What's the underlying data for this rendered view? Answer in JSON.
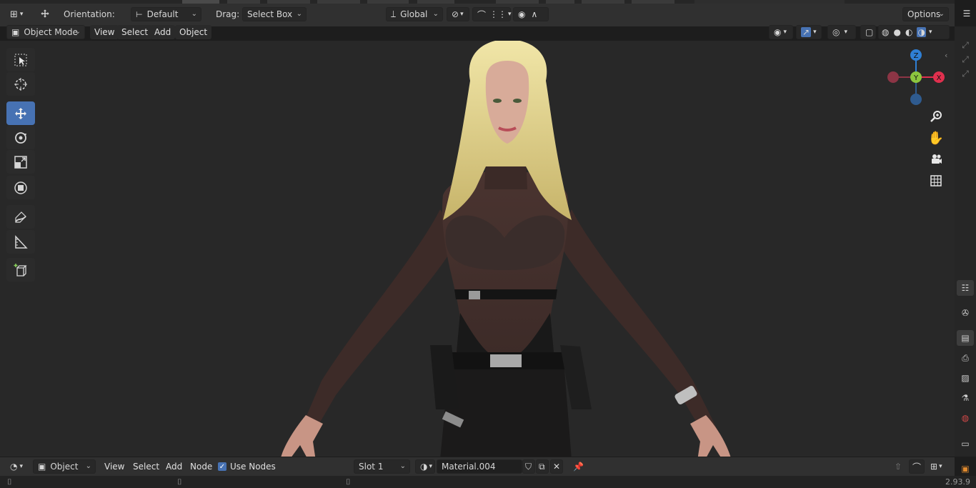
{
  "header": {
    "orientation_label": "Orientation:",
    "orientation_value": "Default",
    "drag_label": "Drag:",
    "drag_value": "Select Box",
    "transform_space": "Global",
    "options_label": "Options"
  },
  "viewport_header": {
    "mode": "Object Mode",
    "menus": [
      "View",
      "Select",
      "Add",
      "Object"
    ]
  },
  "gizmo": {
    "z_label": "Z",
    "y_label": "Y",
    "x_label": "X",
    "colors": {
      "x": "#e0304e",
      "y": "#8cc63f",
      "z": "#2f7fd4"
    }
  },
  "toolbar": {
    "tools": [
      "select-box-tool",
      "cursor-tool",
      "move-tool",
      "rotate-tool",
      "scale-tool",
      "transform-tool",
      "annotate-tool",
      "measure-tool",
      "add-cube-tool"
    ],
    "active": "move-tool"
  },
  "node_editor_header": {
    "editor_type": "Object",
    "menus": [
      "View",
      "Select",
      "Add",
      "Node"
    ],
    "use_nodes_label": "Use Nodes",
    "use_nodes_checked": true,
    "slot": "Slot 1",
    "material_name": "Material.004"
  },
  "status_bar": {
    "version": "2.93.9"
  },
  "colors": {
    "accent": "#4772b3",
    "header_bg": "#303030",
    "viewport_bg": "#282828"
  }
}
